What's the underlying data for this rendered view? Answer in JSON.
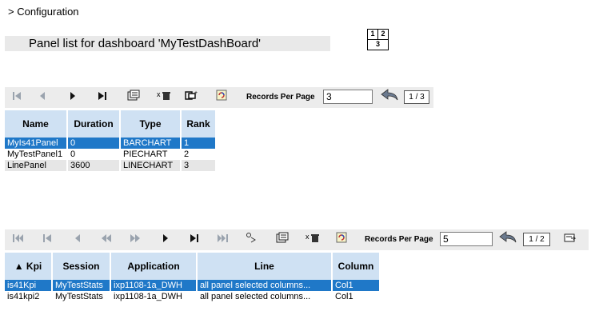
{
  "breadcrumb": "> Configuration",
  "title": "Panel list for dashboard 'MyTestDashBoard'",
  "layout_icon": {
    "cells": [
      "1",
      "2",
      "3"
    ]
  },
  "toolbar1": {
    "records_label": "Records Per Page",
    "records_value": "3",
    "page": "1 / 3"
  },
  "table1": {
    "headers": [
      "Name",
      "Duration",
      "Type",
      "Rank"
    ],
    "rows": [
      [
        "MyIs41Panel",
        "0",
        "BARCHART",
        "1"
      ],
      [
        "MyTestPanel1",
        "0",
        "PIECHART",
        "2"
      ],
      [
        "LinePanel",
        "3600",
        "LINECHART",
        "3"
      ]
    ]
  },
  "toolbar2": {
    "records_label": "Records Per Page",
    "records_value": "5",
    "page": "1 / 2"
  },
  "table2": {
    "headers": [
      "▲ Kpi",
      "Session",
      "Application",
      "Line",
      "Column"
    ],
    "rows": [
      [
        "is41Kpi",
        "MyTestStats",
        "ixp1108-1a_DWH",
        "all panel selected columns...",
        "Col1"
      ],
      [
        "is41kpi2",
        "MyTestStats",
        "ixp1108-1a_DWH",
        "all panel selected columns...",
        "Col1"
      ]
    ]
  },
  "colors": {
    "header_bg": "#cfe1f3",
    "selected_row": "#1f78c8",
    "toolbar_bg": "#ececec"
  }
}
